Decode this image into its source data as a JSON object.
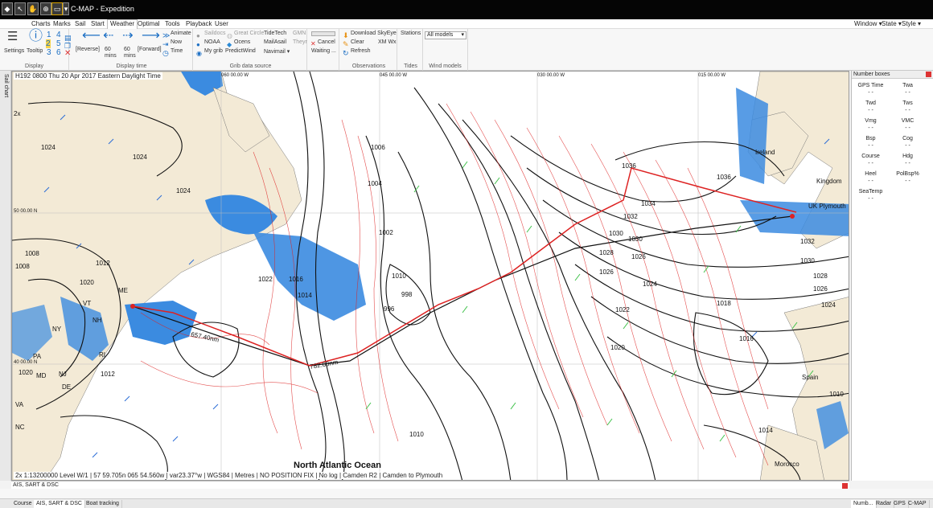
{
  "window": {
    "title": "C-MAP - Expedition"
  },
  "menu": {
    "tabs": [
      "Charts",
      "Marks",
      "Sail",
      "Start",
      "Weather",
      "Optimal",
      "Tools",
      "Playback",
      "User"
    ],
    "active": "Weather",
    "right": [
      "Window ▾",
      "State ▾",
      "Style ▾"
    ]
  },
  "ribbon": {
    "display": {
      "settings": "Settings",
      "tooltip": "Tooltip",
      "nums": [
        "1",
        "4",
        "2",
        "5",
        "3",
        "6"
      ],
      "label": "Display"
    },
    "display_time": {
      "reverse": "[Reverse]",
      "back60": "60\nmins",
      "fwd60": "60\nmins",
      "forward": "[Forward]",
      "animate": "Animate",
      "now": "Now",
      "time": "Time",
      "label": "Display time"
    },
    "grib": {
      "saildocs": "Saildocs",
      "noaa": "NOAA",
      "mygrib": "My grib",
      "greatcircle": "Great Circle",
      "ocens": "Ocens",
      "predictwind": "PredictWind",
      "tidetech": "TideTech",
      "mailasail": "MailAsail",
      "navimail": "Navimail ▾",
      "gmn": "GMN",
      "theyr": "Theyr",
      "label": "Grib data source"
    },
    "progress": {
      "cancel": "Cancel",
      "waiting": "Waiting ..."
    },
    "observations": {
      "download": "Download SkyEye",
      "clear": "Clear",
      "refresh": "Refresh",
      "xmwx": "XM Wx",
      "label": "Observations"
    },
    "tides": {
      "stations": "Stations",
      "label": "Tides"
    },
    "windmodels": {
      "selected": "All models",
      "label": "Wind models"
    }
  },
  "sidebar_tab": "Sail chart",
  "map": {
    "header": "H192 0800 Thu 20 Apr 2017 Eastern Daylight Time",
    "status": "2x 1:13200000 Level W/1 | 57 59.705n 065 54.560w | var23.37°w | WGS84 | Metres | NO POSITION FIX | No log | Camden R2 | Camden to Plymouth",
    "ocean": "North Atlantic Ocean",
    "labels": {
      "ireland": "Ireland",
      "kingdom": "Kingdom",
      "plymouth": "UK Plymouth",
      "spain": "Spain",
      "morocco": "Morocco",
      "me": "ME",
      "vt": "VT",
      "nh": "NH",
      "ny": "NY",
      "ri": "RI",
      "pa": "PA",
      "nj": "NJ",
      "md": "MD",
      "de": "DE",
      "va": "VA",
      "nc": "NC",
      "dist1": "657.40nm",
      "dist2": "782.60nm",
      "zoom": "2x"
    },
    "lon_ticks": [
      "060 00.00 W",
      "045 00.00 W",
      "030 00.00 W",
      "015 00.00 W"
    ],
    "lat_ticks": [
      "50 00.00 N",
      "40 00.00 N"
    ],
    "isobars": [
      "1024",
      "1024",
      "1024",
      "1006",
      "1004",
      "1002",
      "1022",
      "1012",
      "1016",
      "1014",
      "998",
      "996",
      "1010",
      "1036",
      "1036",
      "1034",
      "1032",
      "1030",
      "1028",
      "1026",
      "1024",
      "1022",
      "1020",
      "1018",
      "1016",
      "1014",
      "1010",
      "1008",
      "1032",
      "1030",
      "1028",
      "1026",
      "1024",
      "1020",
      "1030",
      "1026",
      "1008",
      "1012",
      "1020",
      "1010"
    ]
  },
  "number_boxes": {
    "title": "Number boxes",
    "items": [
      {
        "label": "GPS Time",
        "value": "- -"
      },
      {
        "label": "Twa",
        "value": "- -"
      },
      {
        "label": "Twd",
        "value": "- -"
      },
      {
        "label": "Tws",
        "value": "- -"
      },
      {
        "label": "Vmg",
        "value": "- -"
      },
      {
        "label": "VMC",
        "value": "- -"
      },
      {
        "label": "Bsp",
        "value": "- -"
      },
      {
        "label": "Cog",
        "value": "- -"
      },
      {
        "label": "Course",
        "value": "- -"
      },
      {
        "label": "Hdg",
        "value": "- -"
      },
      {
        "label": "Heel",
        "value": "- -"
      },
      {
        "label": "PolBsp%",
        "value": "- -"
      },
      {
        "label": "SeaTemp",
        "value": "- -"
      }
    ]
  },
  "bottom_panel": {
    "title": "AIS, SART & DSC"
  },
  "bottom_tabs": [
    "Course",
    "AIS, SART & DSC",
    "Boat tracking"
  ],
  "right_tabs": [
    "Numb...",
    "Radar",
    "GPS",
    "C-MAP"
  ],
  "colors": {
    "isobar": "#111111",
    "route": "#dd2222",
    "wind_green": "#3fc24a",
    "wind_blue": "#2a6cd6",
    "water": "#3b8be0",
    "land": "#f3ead6"
  }
}
